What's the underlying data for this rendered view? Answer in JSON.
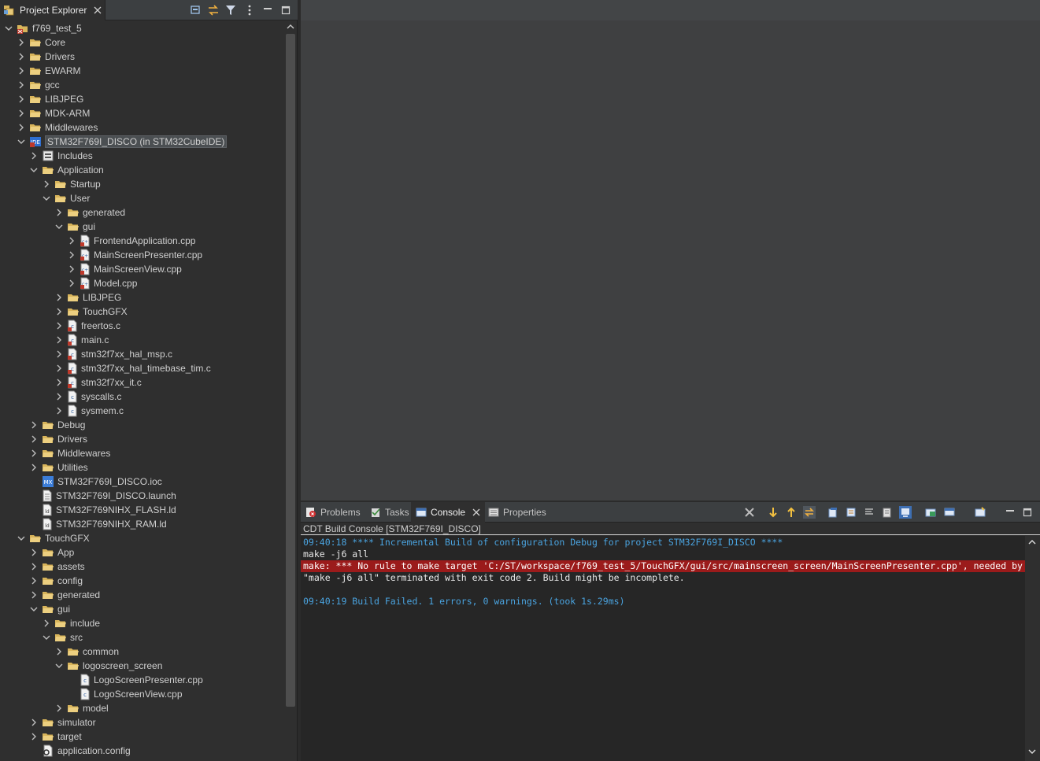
{
  "project_explorer": {
    "tab_label": "Project Explorer",
    "toolbar": [
      "collapse-all-icon",
      "link-with-editor-icon",
      "filter-icon",
      "view-menu-icon",
      "minimize-icon",
      "maximize-icon"
    ]
  },
  "tree": [
    {
      "label": "f769_test_5",
      "depth": 0,
      "expanded": true,
      "icon": "project-icon"
    },
    {
      "label": "Core",
      "depth": 1,
      "expanded": false,
      "icon": "folder-icon"
    },
    {
      "label": "Drivers",
      "depth": 1,
      "expanded": false,
      "icon": "folder-icon"
    },
    {
      "label": "EWARM",
      "depth": 1,
      "expanded": false,
      "icon": "folder-icon"
    },
    {
      "label": "gcc",
      "depth": 1,
      "expanded": false,
      "icon": "folder-icon"
    },
    {
      "label": "LIBJPEG",
      "depth": 1,
      "expanded": false,
      "icon": "folder-icon"
    },
    {
      "label": "MDK-ARM",
      "depth": 1,
      "expanded": false,
      "icon": "folder-icon"
    },
    {
      "label": "Middlewares",
      "depth": 1,
      "expanded": false,
      "icon": "folder-icon"
    },
    {
      "label": "STM32F769I_DISCO (in STM32CubeIDE)",
      "depth": 1,
      "expanded": true,
      "icon": "ide-project-icon",
      "selected": true
    },
    {
      "label": "Includes",
      "depth": 2,
      "expanded": false,
      "icon": "includes-icon"
    },
    {
      "label": "Application",
      "depth": 2,
      "expanded": true,
      "icon": "folder-icon"
    },
    {
      "label": "Startup",
      "depth": 3,
      "expanded": false,
      "icon": "folder-icon"
    },
    {
      "label": "User",
      "depth": 3,
      "expanded": true,
      "icon": "folder-icon"
    },
    {
      "label": "generated",
      "depth": 4,
      "expanded": false,
      "icon": "folder-icon"
    },
    {
      "label": "gui",
      "depth": 4,
      "expanded": true,
      "icon": "folder-icon"
    },
    {
      "label": "FrontendApplication.cpp",
      "depth": 5,
      "expanded": false,
      "icon": "cpp-file-error-icon"
    },
    {
      "label": "MainScreenPresenter.cpp",
      "depth": 5,
      "expanded": false,
      "icon": "cpp-file-error-icon"
    },
    {
      "label": "MainScreenView.cpp",
      "depth": 5,
      "expanded": false,
      "icon": "cpp-file-error-icon"
    },
    {
      "label": "Model.cpp",
      "depth": 5,
      "expanded": false,
      "icon": "cpp-file-error-icon"
    },
    {
      "label": "LIBJPEG",
      "depth": 4,
      "expanded": false,
      "icon": "folder-icon"
    },
    {
      "label": "TouchGFX",
      "depth": 4,
      "expanded": false,
      "icon": "folder-icon"
    },
    {
      "label": "freertos.c",
      "depth": 4,
      "expanded": false,
      "icon": "c-file-error-icon"
    },
    {
      "label": "main.c",
      "depth": 4,
      "expanded": false,
      "icon": "c-file-error-icon"
    },
    {
      "label": "stm32f7xx_hal_msp.c",
      "depth": 4,
      "expanded": false,
      "icon": "c-file-error-icon"
    },
    {
      "label": "stm32f7xx_hal_timebase_tim.c",
      "depth": 4,
      "expanded": false,
      "icon": "c-file-error-icon"
    },
    {
      "label": "stm32f7xx_it.c",
      "depth": 4,
      "expanded": false,
      "icon": "c-file-error-icon"
    },
    {
      "label": "syscalls.c",
      "depth": 4,
      "expanded": false,
      "icon": "c-file-icon"
    },
    {
      "label": "sysmem.c",
      "depth": 4,
      "expanded": false,
      "icon": "c-file-icon"
    },
    {
      "label": "Debug",
      "depth": 2,
      "expanded": false,
      "icon": "folder-icon"
    },
    {
      "label": "Drivers",
      "depth": 2,
      "expanded": false,
      "icon": "folder-icon"
    },
    {
      "label": "Middlewares",
      "depth": 2,
      "expanded": false,
      "icon": "folder-icon"
    },
    {
      "label": "Utilities",
      "depth": 2,
      "expanded": false,
      "icon": "folder-icon"
    },
    {
      "label": "STM32F769I_DISCO.ioc",
      "depth": 2,
      "leaf": true,
      "icon": "ioc-file-icon"
    },
    {
      "label": "STM32F769I_DISCO.launch",
      "depth": 2,
      "leaf": true,
      "icon": "launch-file-icon"
    },
    {
      "label": "STM32F769NIHX_FLASH.ld",
      "depth": 2,
      "leaf": true,
      "icon": "ld-file-icon"
    },
    {
      "label": "STM32F769NIHX_RAM.ld",
      "depth": 2,
      "leaf": true,
      "icon": "ld-file-icon"
    },
    {
      "label": "TouchGFX",
      "depth": 1,
      "expanded": true,
      "icon": "folder-icon"
    },
    {
      "label": "App",
      "depth": 2,
      "expanded": false,
      "icon": "folder-icon"
    },
    {
      "label": "assets",
      "depth": 2,
      "expanded": false,
      "icon": "folder-icon"
    },
    {
      "label": "config",
      "depth": 2,
      "expanded": false,
      "icon": "folder-icon"
    },
    {
      "label": "generated",
      "depth": 2,
      "expanded": false,
      "icon": "folder-icon"
    },
    {
      "label": "gui",
      "depth": 2,
      "expanded": true,
      "icon": "folder-icon"
    },
    {
      "label": "include",
      "depth": 3,
      "expanded": false,
      "icon": "folder-icon"
    },
    {
      "label": "src",
      "depth": 3,
      "expanded": true,
      "icon": "folder-icon"
    },
    {
      "label": "common",
      "depth": 4,
      "expanded": false,
      "icon": "folder-icon"
    },
    {
      "label": "logoscreen_screen",
      "depth": 4,
      "expanded": true,
      "icon": "folder-icon"
    },
    {
      "label": "LogoScreenPresenter.cpp",
      "depth": 5,
      "leaf": true,
      "icon": "cpp-file-icon"
    },
    {
      "label": "LogoScreenView.cpp",
      "depth": 5,
      "leaf": true,
      "icon": "cpp-file-icon"
    },
    {
      "label": "model",
      "depth": 4,
      "expanded": false,
      "icon": "folder-icon"
    },
    {
      "label": "simulator",
      "depth": 2,
      "expanded": false,
      "icon": "folder-icon"
    },
    {
      "label": "target",
      "depth": 2,
      "expanded": false,
      "icon": "folder-icon"
    },
    {
      "label": "application.config",
      "depth": 2,
      "leaf": true,
      "icon": "config-file-icon"
    }
  ],
  "console_view": {
    "tabs": [
      {
        "label": "Problems",
        "icon": "problems-icon",
        "active": false
      },
      {
        "label": "Tasks",
        "icon": "tasks-icon",
        "active": false
      },
      {
        "label": "Console",
        "icon": "console-icon",
        "active": true
      },
      {
        "label": "Properties",
        "icon": "properties-icon",
        "active": false
      }
    ],
    "toolbar": [
      "remove-all-icon",
      "next-error-icon",
      "previous-error-icon",
      "link-icon",
      "copy-build-log-icon",
      "clear-console-icon",
      "word-wrap-icon",
      "scroll-lock-icon",
      "pin-console-icon",
      "display-selected-console-icon",
      "open-console-icon",
      "minimize-icon",
      "maximize-icon"
    ],
    "title": "CDT Build Console [STM32F769I_DISCO]",
    "lines": [
      {
        "type": "info",
        "text": "09:40:18 **** Incremental Build of configuration Debug for project STM32F769I_DISCO ****"
      },
      {
        "type": "normal",
        "text": "make -j6 all"
      },
      {
        "type": "error",
        "text": "make: *** No rule to make target 'C:/ST/workspace/f769_test_5/TouchGFX/gui/src/mainscreen_screen/MainScreenPresenter.cpp', needed by"
      },
      {
        "type": "normal",
        "text": "\"make -j6 all\" terminated with exit code 2. Build might be incomplete."
      },
      {
        "type": "blank",
        "text": ""
      },
      {
        "type": "info",
        "text": "09:40:19 Build Failed. 1 errors, 0 warnings. (took 1s.29ms)"
      }
    ]
  },
  "colors": {
    "folder": "#d8b45a",
    "error_bg": "#9b1b1b",
    "info_text": "#4aa3df",
    "selection": "#4b4f52"
  }
}
